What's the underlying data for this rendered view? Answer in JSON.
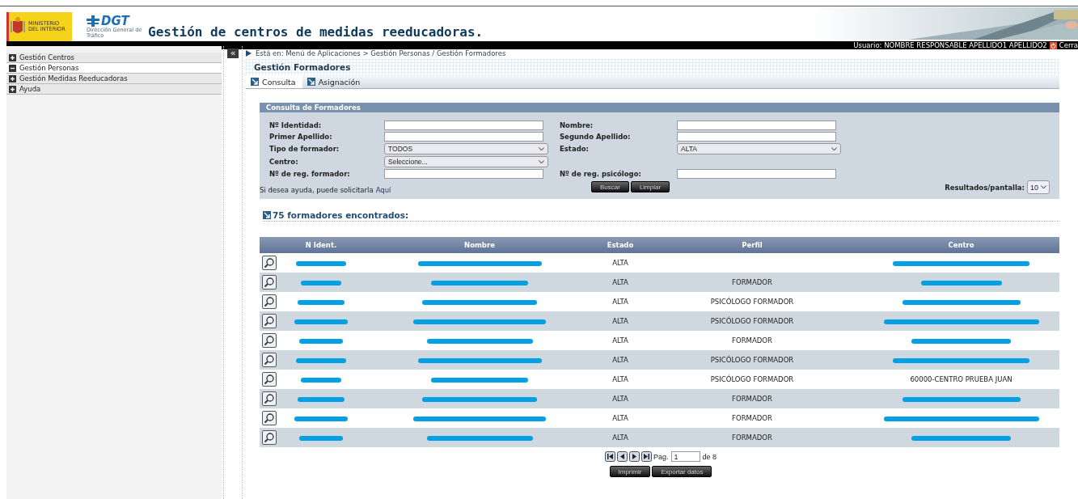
{
  "header": {
    "ministry": "MINISTERIO DEL INTERIOR",
    "agency_logo": "DGT",
    "agency_caption": "Dirección General de Tráfico",
    "title": "Gestión de centros de medidas reeducadoras.",
    "user": "Usuario: NOMBRE RESPONSABLE APELLIDO1 APELLIDO2",
    "logout": "Cerra"
  },
  "sidebar": {
    "collapse_button": "«",
    "items": [
      {
        "label": "Gestión Centros",
        "expanded": false,
        "selected": false
      },
      {
        "label": "Gestión Personas",
        "expanded": true,
        "selected": true
      },
      {
        "label": "Gestión Medidas Reeducadoras",
        "expanded": false,
        "selected": false
      },
      {
        "label": "Ayuda",
        "expanded": false,
        "selected": false
      }
    ]
  },
  "breadcrumb": "Está en: Menú de Aplicaciones  > Gestión Personas  / Gestión Formadores",
  "page_title": "Gestión Formadores",
  "tabs": [
    {
      "label": "Consulta",
      "selected": true
    },
    {
      "label": "Asignación",
      "selected": false
    }
  ],
  "search_form": {
    "title": "Consulta de Formadores",
    "rows": [
      {
        "left": {
          "label": "Nº Identidad:",
          "kind": "text"
        },
        "right": {
          "label": "Nombre:",
          "kind": "text"
        }
      },
      {
        "left": {
          "label": "Primer Apellido:",
          "kind": "text"
        },
        "right": {
          "label": "Segundo Apellido:",
          "kind": "text"
        }
      },
      {
        "left": {
          "label": "Tipo de formador:",
          "kind": "select",
          "value": "TODOS"
        },
        "right": {
          "label": "Estado:",
          "kind": "select",
          "value": "ALTA"
        }
      },
      {
        "left": {
          "label": "Centro:",
          "kind": "select",
          "value": "Seleccione..."
        }
      },
      {
        "left": {
          "label": "Nº de reg. formador:",
          "kind": "text"
        },
        "right": {
          "label": "Nº de reg. psicólogo:",
          "kind": "text"
        }
      }
    ],
    "buttons": [
      "Buscar",
      "Limpiar"
    ],
    "help_text": "Si desea ayuda, puede solicitarla",
    "help_link": "Aquí",
    "page_size_label": "Resultados/pantalla:",
    "page_size": "10"
  },
  "results": {
    "count_text": "75 formadores encontrados:",
    "columns": [
      "N Ident.",
      "Nombre",
      "Estado",
      "Perfil",
      "Centro"
    ],
    "rows": [
      {
        "estado": "ALTA",
        "ident_redacted": true,
        "nombre_redacted": true,
        "centro_redacted": true
      },
      {
        "estado": "ALTA",
        "perfil": "FORMADOR",
        "ident_redacted": true,
        "nombre_redacted": true,
        "centro_redacted": true
      },
      {
        "estado": "ALTA",
        "perfil": "PSICÓLOGO FORMADOR",
        "ident_redacted": true,
        "nombre_redacted": true,
        "centro_redacted": true
      },
      {
        "estado": "ALTA",
        "perfil": "PSICÓLOGO FORMADOR",
        "ident_redacted": true,
        "nombre_redacted": true,
        "centro_redacted": true
      },
      {
        "estado": "ALTA",
        "perfil": "FORMADOR",
        "ident_redacted": true,
        "nombre_redacted": true,
        "centro_redacted": true
      },
      {
        "estado": "ALTA",
        "perfil": "PSICÓLOGO FORMADOR",
        "ident_redacted": true,
        "nombre_redacted": true,
        "centro_redacted": true
      },
      {
        "estado": "ALTA",
        "perfil": "PSICÓLOGO FORMADOR",
        "centro": "60000-CENTRO PRUEBA JUAN",
        "ident_redacted": true,
        "nombre_redacted": true
      },
      {
        "estado": "ALTA",
        "perfil": "FORMADOR",
        "ident_redacted": true,
        "nombre_redacted": true,
        "centro_redacted": true
      },
      {
        "estado": "ALTA",
        "perfil": "FORMADOR",
        "ident_redacted": true,
        "nombre_redacted": true,
        "centro_redacted": true
      },
      {
        "estado": "ALTA",
        "perfil": "FORMADOR",
        "ident_redacted": true,
        "nombre_redacted": true,
        "centro_redacted": true
      }
    ]
  },
  "pagination": {
    "page_label": "Pag.",
    "page": "1",
    "total": "de 8"
  },
  "actions": [
    "Imprimir",
    "Exportar datos"
  ]
}
